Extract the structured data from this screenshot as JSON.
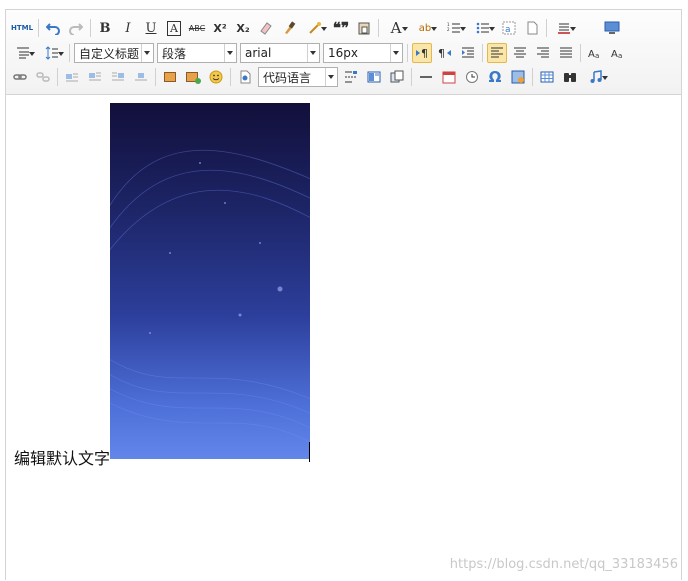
{
  "toolbar": {
    "html_label": "HTML",
    "bold": "B",
    "italic": "I",
    "underline": "U",
    "fontborder": "A",
    "strikethrough": "ABC",
    "superscript": "X²",
    "subscript": "X₂",
    "blockquote": "❝❞",
    "forecolor": "A",
    "backcolor": "ab",
    "paragraph_style": "自定义标题",
    "paragraph_format": "段落",
    "font_family": "arial",
    "font_size": "16px",
    "code_language": "代码语言",
    "omega": "Ω"
  },
  "content": {
    "default_text": "编辑默认文字"
  },
  "watermark": "https://blog.csdn.net/qq_33183456",
  "colors": {
    "active_bg": "#fbe6a9",
    "icon_blue": "#3a78c8"
  }
}
